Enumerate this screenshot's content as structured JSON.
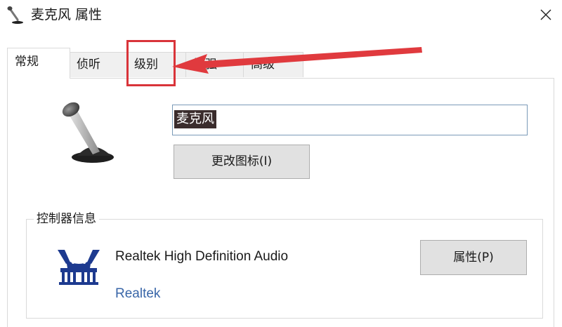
{
  "window": {
    "title": "麦克风 属性",
    "icon": "microphone-icon",
    "close_icon": "close-icon"
  },
  "tabs": [
    {
      "label": "常规",
      "active": true
    },
    {
      "label": "侦听",
      "active": false
    },
    {
      "label": "级别",
      "active": false,
      "highlighted": true
    },
    {
      "label": "增强",
      "active": false
    },
    {
      "label": "高级",
      "active": false
    }
  ],
  "annotation": {
    "color": "#d9343a",
    "type": "red-box-and-arrow"
  },
  "general": {
    "device_icon": "microphone-icon",
    "name_value": "麦克风",
    "change_icon_label": "更改图标(I)"
  },
  "controller": {
    "legend": "控制器信息",
    "logo": "realtek-logo-icon",
    "device_name": "Realtek High Definition Audio",
    "vendor": "Realtek",
    "properties_label": "属性(P)"
  },
  "colors": {
    "link": "#3966a8",
    "selection_bg": "#3a2c2c",
    "button_bg": "#e1e1e1",
    "realtek_blue": "#1d3a8f"
  }
}
